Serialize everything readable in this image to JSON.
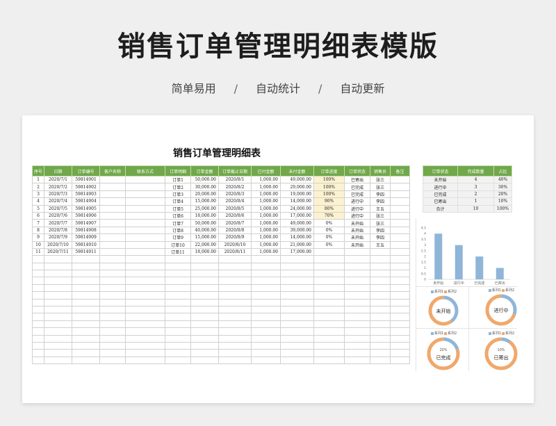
{
  "header": {
    "title": "销售订单管理明细表模版",
    "features": [
      "简单易用",
      "自动统计",
      "自动更新"
    ],
    "separator": "/"
  },
  "sheet": {
    "title": "销售订单管理明细表",
    "columns": [
      "序号",
      "日期",
      "订单编号",
      "客户名称",
      "联系方式",
      "订单明细",
      "订单金额",
      "订单截止日期",
      "已付金额",
      "未付金额",
      "订单进度",
      "订单状态",
      "销售员",
      "备注"
    ],
    "rows": [
      [
        "1",
        "2020/7/1",
        "59814901",
        "",
        "",
        "订单1",
        "50,000.00",
        "2020/8/1",
        "1,000.00",
        "49,000.00",
        "100%",
        "已寄出",
        "张三",
        ""
      ],
      [
        "2",
        "2020/7/2",
        "59814902",
        "",
        "",
        "订单2",
        "30,000.00",
        "2020/8/2",
        "1,000.00",
        "29,000.00",
        "100%",
        "已完成",
        "张三",
        ""
      ],
      [
        "3",
        "2020/7/3",
        "59814903",
        "",
        "",
        "订单3",
        "20,000.00",
        "2020/8/3",
        "1,000.00",
        "19,000.00",
        "100%",
        "已完成",
        "李四",
        ""
      ],
      [
        "4",
        "2020/7/4",
        "59814904",
        "",
        "",
        "订单4",
        "15,000.00",
        "2020/8/4",
        "1,000.00",
        "14,000.00",
        "90%",
        "进行中",
        "李四",
        ""
      ],
      [
        "5",
        "2020/7/5",
        "59814905",
        "",
        "",
        "订单5",
        "25,000.00",
        "2020/8/5",
        "1,000.00",
        "24,000.00",
        "80%",
        "进行中",
        "王五",
        ""
      ],
      [
        "6",
        "2020/7/6",
        "59814906",
        "",
        "",
        "订单6",
        "18,000.00",
        "2020/8/6",
        "1,000.00",
        "17,000.00",
        "70%",
        "进行中",
        "张三",
        ""
      ],
      [
        "7",
        "2020/7/7",
        "59814907",
        "",
        "",
        "订单7",
        "50,000.00",
        "2020/8/7",
        "1,000.00",
        "49,000.00",
        "0%",
        "未开始",
        "张三",
        ""
      ],
      [
        "8",
        "2020/7/8",
        "59814908",
        "",
        "",
        "订单8",
        "40,000.00",
        "2020/8/8",
        "1,000.00",
        "39,000.00",
        "0%",
        "未开始",
        "李四",
        ""
      ],
      [
        "9",
        "2020/7/9",
        "59814909",
        "",
        "",
        "订单9",
        "15,000.00",
        "2020/8/9",
        "1,000.00",
        "14,000.00",
        "0%",
        "未开始",
        "李四",
        ""
      ],
      [
        "10",
        "2020/7/10",
        "59814910",
        "",
        "",
        "订单10",
        "22,000.00",
        "2020/8/10",
        "1,000.00",
        "21,000.00",
        "0%",
        "未开始",
        "王五",
        ""
      ],
      [
        "11",
        "2020/7/11",
        "59814911",
        "",
        "",
        "订单11",
        "18,000.00",
        "2020/8/11",
        "1,000.00",
        "17,000.00",
        "",
        "",
        "",
        ""
      ]
    ],
    "highlight_color": "#fdf2d0",
    "header_color": "#70a84a"
  },
  "status_summary": {
    "columns": [
      "订单状态",
      "完成数量",
      "占比"
    ],
    "rows": [
      [
        "未开始",
        "4",
        "40%"
      ],
      [
        "进行中",
        "3",
        "30%"
      ],
      [
        "已完成",
        "2",
        "20%"
      ],
      [
        "已寄出",
        "1",
        "10%"
      ],
      [
        "合计",
        "10",
        "100%"
      ]
    ]
  },
  "chart_data": [
    {
      "type": "bar",
      "categories": [
        "未开始",
        "进行中",
        "已完成",
        "已寄出"
      ],
      "values": [
        4,
        3,
        2,
        1
      ],
      "ylim": [
        0,
        4.5
      ],
      "yticks": [
        "0",
        "0.5",
        "1",
        "1.5",
        "2",
        "2.5",
        "3",
        "3.5",
        "4",
        "4.5"
      ],
      "color": "#8fb6d8",
      "grid": false
    },
    {
      "type": "pie",
      "label": "未开始",
      "legend": [
        "系列1",
        "系列2"
      ],
      "values": [
        40,
        60
      ],
      "percent_label": "",
      "colors": [
        "#8fb6d8",
        "#f0a86c"
      ]
    },
    {
      "type": "pie",
      "label": "进行中",
      "legend": [
        "系列1",
        "系列2"
      ],
      "values": [
        30,
        70
      ],
      "percent_label": "",
      "colors": [
        "#8fb6d8",
        "#f0a86c"
      ]
    },
    {
      "type": "pie",
      "label": "已完成",
      "legend": [
        "系列1",
        "系列2"
      ],
      "values": [
        20,
        80
      ],
      "percent_label": "20%",
      "colors": [
        "#8fb6d8",
        "#f0a86c"
      ]
    },
    {
      "type": "pie",
      "label": "已寄出",
      "legend": [
        "系列1",
        "系列2"
      ],
      "values": [
        10,
        90
      ],
      "percent_label": "10%",
      "colors": [
        "#8fb6d8",
        "#f0a86c"
      ]
    }
  ]
}
